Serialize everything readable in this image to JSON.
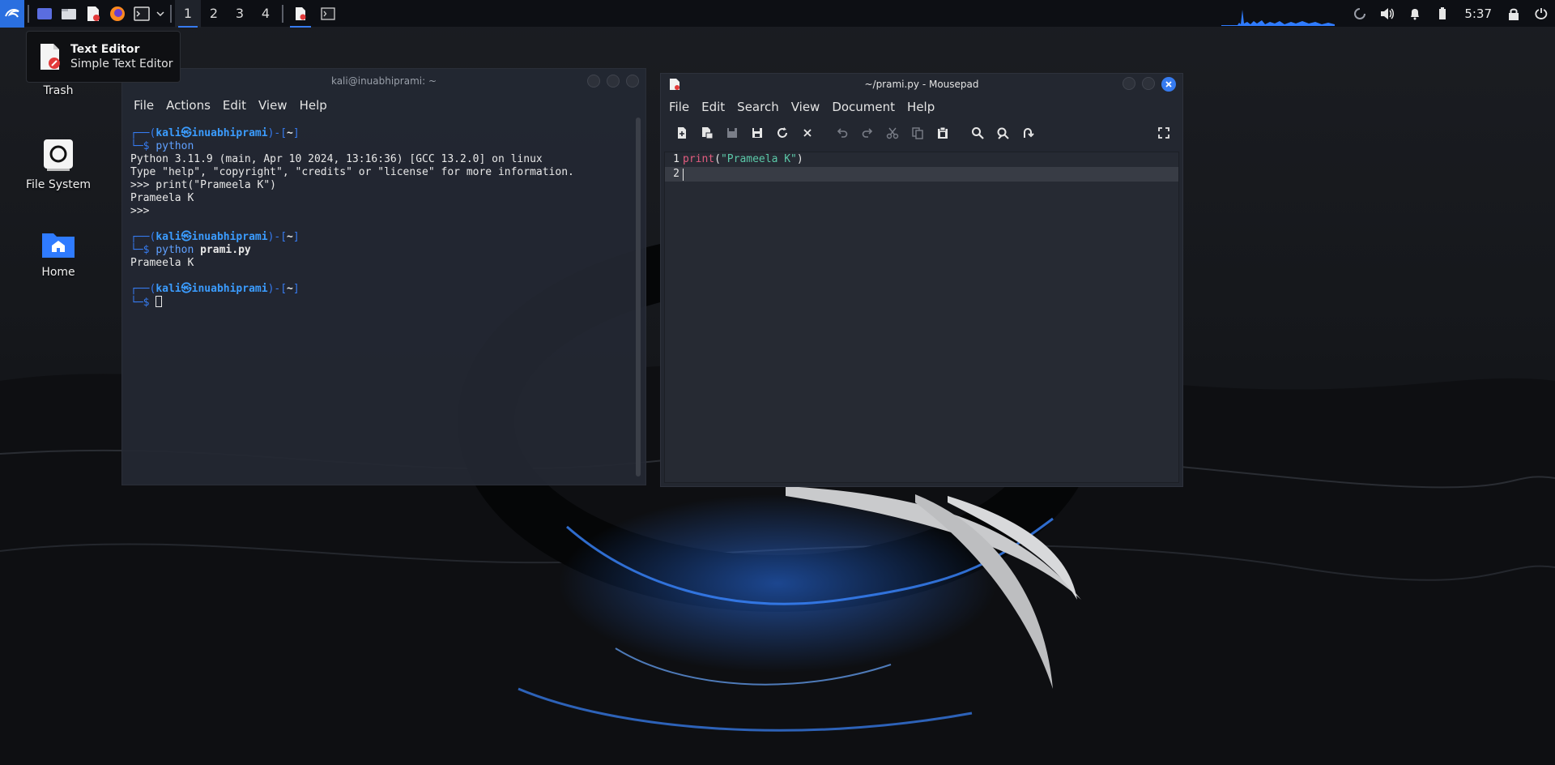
{
  "panel": {
    "workspaces": [
      "1",
      "2",
      "3",
      "4"
    ],
    "active_workspace": "1",
    "clock": "5:37",
    "accent": "#367bf0"
  },
  "desktop": {
    "icons": [
      {
        "label": "Trash",
        "icon": "trash-icon"
      },
      {
        "label": "File System",
        "icon": "drive-icon"
      },
      {
        "label": "Home",
        "icon": "home-folder-icon"
      }
    ]
  },
  "tooltip": {
    "title": "Text Editor",
    "subtitle": "Simple Text Editor",
    "icon": "text-editor-icon"
  },
  "terminal": {
    "title": "kali@inuabhiprami: ~",
    "menu": [
      "File",
      "Actions",
      "Edit",
      "View",
      "Help"
    ],
    "prompt_user": "kali",
    "prompt_host": "inuabhiprami",
    "prompt_dir": "~",
    "cmd1": "python",
    "py_banner1": "Python 3.11.9 (main, Apr 10 2024, 13:16:36) [GCC 13.2.0] on linux",
    "py_banner2": "Type \"help\", \"copyright\", \"credits\" or \"license\" for more information.",
    "py_input": ">>> print(\"Prameela K\")",
    "py_output": "Prameela K",
    "py_prompt": ">>>",
    "cmd2_a": "python",
    "cmd2_b": "prami.py",
    "cmd2_output": "Prameela K"
  },
  "editor": {
    "title": "~/prami.py - Mousepad",
    "menu": [
      "File",
      "Edit",
      "Search",
      "View",
      "Document",
      "Help"
    ],
    "lines": [
      {
        "num": "1",
        "kw": "print",
        "open": "(",
        "str": "\"Prameela K\"",
        "close": ")"
      },
      {
        "num": "2"
      }
    ]
  }
}
